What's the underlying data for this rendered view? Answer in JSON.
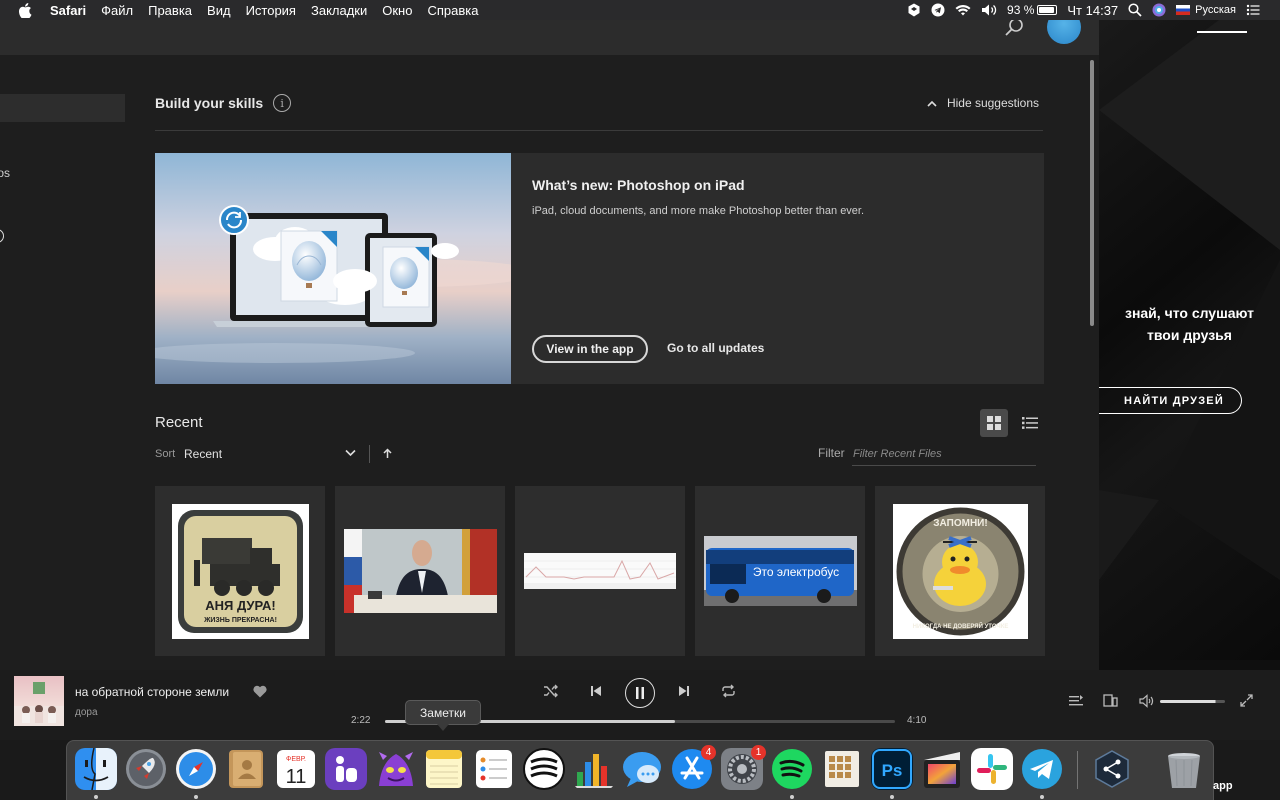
{
  "menubar": {
    "app_name": "Safari",
    "items": [
      "Файл",
      "Правка",
      "Вид",
      "История",
      "Закладки",
      "Окно",
      "Справка"
    ],
    "battery_text": "93 %",
    "battery_level": 0.93,
    "clock": "Чт 14:37",
    "input_language": "Русская"
  },
  "photoshop": {
    "skills": {
      "title": "Build your skills",
      "info_icon": "i",
      "hide_label": "Hide suggestions"
    },
    "feature": {
      "title": "What’s new: Photoshop on iPad",
      "description": "iPad, cloud documents, and more make Photoshop better than ever.",
      "view_button": "View in the app",
      "all_updates": "Go to all updates"
    },
    "recent": {
      "title": "Recent",
      "sort_label": "Sort",
      "sort_value": "Recent",
      "filter_label": "Filter",
      "filter_placeholder": "Filter Recent Files"
    },
    "sidebar_fragment": "tos"
  },
  "music_bg": {
    "promo_line1": "знай, что слушают",
    "promo_line2": "твои друзья",
    "find_button": "НАЙТИ ДРУЗЕЙ"
  },
  "player": {
    "track_title": "на обратной стороне земли",
    "artist": "дора",
    "time_current": "2:22",
    "time_total": "4:10",
    "progress": 0.568,
    "volume": 0.85,
    "tooltip": "Заметки"
  },
  "dock": {
    "app_store_badge": "4",
    "settings_badge": "1",
    "calendar_month": "ФЕВР.",
    "calendar_day": "11",
    "ps_label": "Ps",
    "trailing_label": "app"
  },
  "thumbnails": {
    "patch1_line1": "АНЯ ДУРА!",
    "patch1_line2": "ЖИЗНЬ ПРЕКРАСНА!",
    "bus_text": "Это электробус",
    "patch2_top": "ЗАПОМНИ!",
    "patch2_bottom": "НИКОГДА НЕ ДОВЕРЯЙ УТОЧКЕ"
  },
  "colors": {
    "ps_bg": "#1e1e1e",
    "ps_card": "#2c2c2c",
    "accent_blue": "#2a86c9",
    "badge_red": "#e5332a"
  }
}
